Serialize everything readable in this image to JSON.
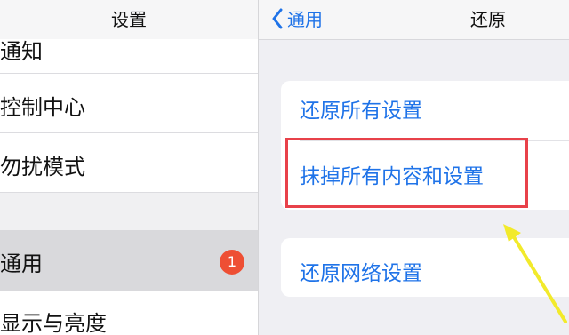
{
  "left_panel": {
    "title": "设置",
    "items": [
      {
        "label": "通知"
      },
      {
        "label": "控制中心"
      },
      {
        "label": "勿扰模式"
      },
      {
        "label": "通用",
        "badge": "1",
        "selected": true
      },
      {
        "label": "显示与亮度"
      }
    ]
  },
  "right_panel": {
    "back_label": "通用",
    "title": "还原",
    "options": {
      "reset_all": "还原所有设置",
      "erase_all": "抹掉所有内容和设置",
      "reset_network": "还原网络设置"
    }
  },
  "colors": {
    "accent": "#1f73e8",
    "badge": "#ee4f34",
    "highlight": "#e8414a",
    "arrow": "#f2ea2b"
  },
  "icons": {
    "back": "chevron-left-icon",
    "annotation": "arrow-annotation"
  }
}
